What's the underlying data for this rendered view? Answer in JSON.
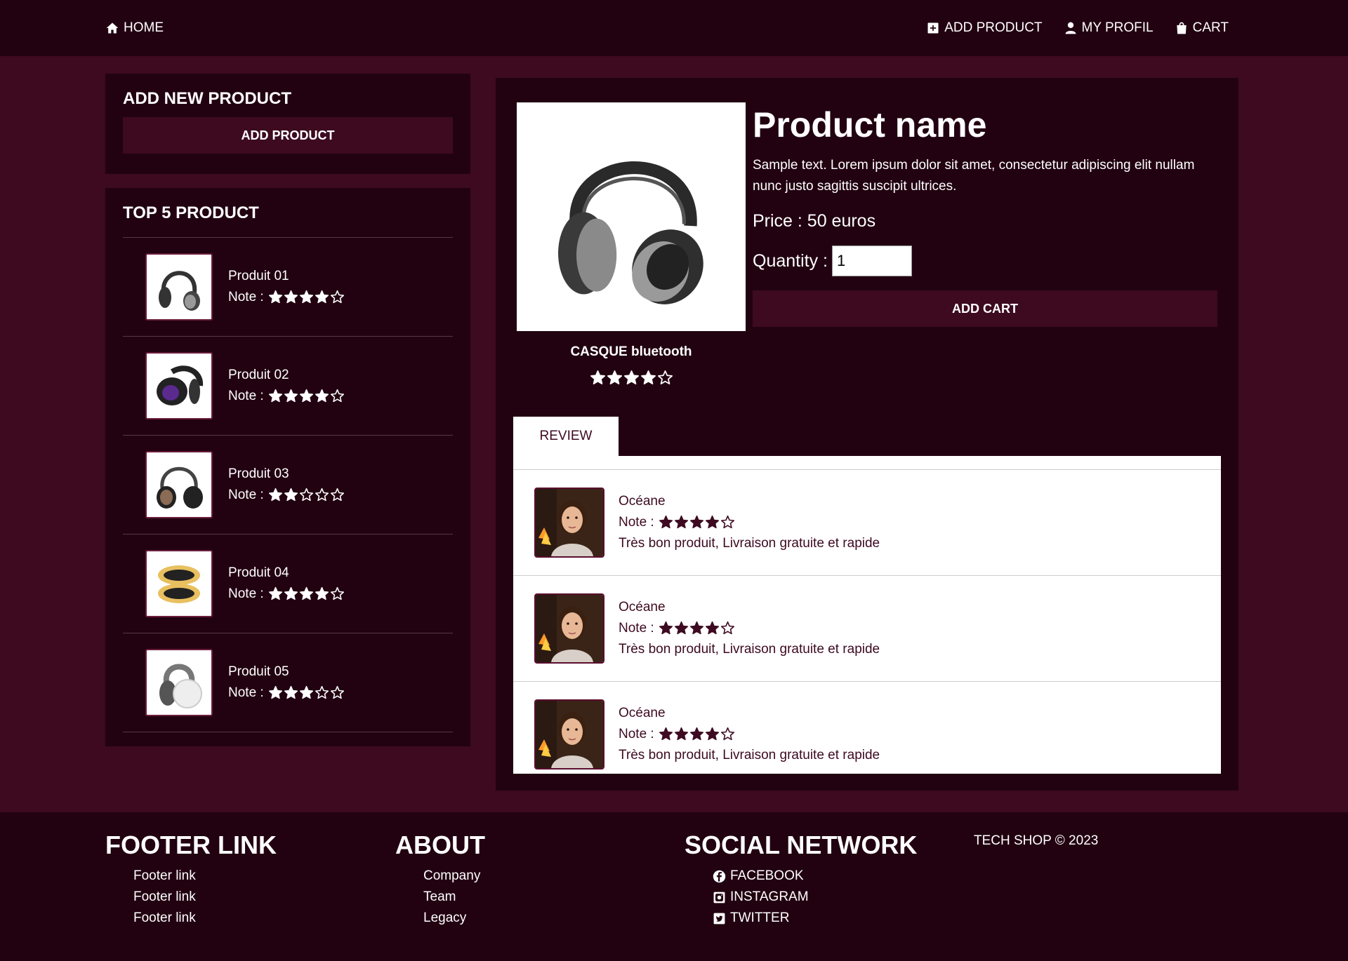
{
  "nav": {
    "home": "HOME",
    "add_product": "ADD PRODUCT",
    "my_profil": "MY PROFIL",
    "cart": "CART"
  },
  "add_panel": {
    "title": "ADD NEW PRODUCT",
    "button": "ADD PRODUCT"
  },
  "top_panel": {
    "title": "TOP 5 PRODUCT",
    "note_label": "Note :",
    "items": [
      {
        "name": "Produit 01",
        "rating": 4,
        "image": "headphones-black"
      },
      {
        "name": "Produit 02",
        "rating": 4,
        "image": "headphones-purple"
      },
      {
        "name": "Produit 03",
        "rating": 2,
        "image": "headphones-studio"
      },
      {
        "name": "Produit 04",
        "rating": 4,
        "image": "headphones-yellow"
      },
      {
        "name": "Produit 05",
        "rating": 3,
        "image": "headphones-white"
      }
    ]
  },
  "product": {
    "name": "Product name",
    "description": "Sample text. Lorem ipsum dolor sit amet, consectetur adipiscing elit nullam nunc justo sagittis suscipit ultrices.",
    "price": "Price : 50 euros",
    "quantity_label": "Quantity :",
    "quantity_value": "1",
    "add_cart": "ADD CART",
    "caption": "CASQUE bluetooth",
    "rating": 4
  },
  "reviews": {
    "tab_label": "REVIEW",
    "note_label": "Note :",
    "items": [
      {
        "author": "Océane",
        "rating": 4,
        "text": "Très bon produit, Livraison gratuite et rapide"
      },
      {
        "author": "Océane",
        "rating": 4,
        "text": "Très bon produit, Livraison gratuite et rapide"
      },
      {
        "author": "Océane",
        "rating": 4,
        "text": "Très bon produit, Livraison gratuite et rapide"
      }
    ]
  },
  "footer": {
    "col1": {
      "title": "FOOTER LINK",
      "links": [
        "Footer link",
        "Footer link",
        "Footer link"
      ]
    },
    "col2": {
      "title": "ABOUT",
      "links": [
        "Company",
        "Team",
        "Legacy"
      ]
    },
    "col3": {
      "title": "SOCIAL NETWORK",
      "links": [
        "FACEBOOK",
        "INSTAGRAM",
        "TWITTER"
      ]
    },
    "copyright": "TECH SHOP © 2023"
  },
  "colors": {
    "background": "#3d0a20",
    "panel": "#220211",
    "accent": "#3d0a20",
    "text_dark": "#3d0a20"
  }
}
